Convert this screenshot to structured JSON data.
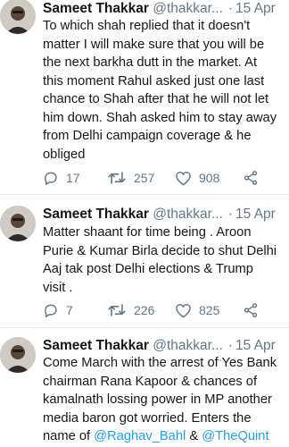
{
  "tweets": [
    {
      "author": "Sameet Thakkar",
      "handle": "@thakkar...",
      "date": "15 Apr",
      "lines": [
        "To which shah replied that it doesn't",
        "matter I will make sure that you will be",
        "the next barkha dutt in the market. At",
        "this moment Rahul asked just one last",
        "chance to Shah after that he will not let",
        "him down. Shah asked him to stay away",
        "from Delhi campaign coverage & he",
        "obliged"
      ],
      "reply_count": "17",
      "retweet_count": "257",
      "like_count": "908"
    },
    {
      "author": "Sameet Thakkar",
      "handle": "@thakkar...",
      "date": "15 Apr",
      "lines": [
        "Matter shaant for time being . Aroon",
        "Purie & Kumar Birla decide to shut Delhi",
        "Aaj tak post Delhi elections & Trump",
        "visit ."
      ],
      "reply_count": "7",
      "retweet_count": "226",
      "like_count": "825"
    },
    {
      "author": "Sameet Thakkar",
      "handle": "@thakkar...",
      "date": "15 Apr",
      "lines": [
        "Come March  with the arrest of Yes Bank",
        "chairman Rana Kapoor & chances of",
        "kamalnath lossing power in MP another",
        "media baron got worried. Enters the"
      ],
      "last_line_prefix": "name of ",
      "mention_1": "@Raghav_Bahl",
      "amp": " & ",
      "mention_2": "@TheQuint"
    }
  ],
  "icons": {
    "reply": "reply-icon",
    "retweet": "retweet-icon",
    "like": "heart-icon",
    "share": "share-icon"
  },
  "colors": {
    "text": "#14171a",
    "secondary": "#657786",
    "link": "#1da1f2",
    "divider": "#e6ecf0"
  }
}
